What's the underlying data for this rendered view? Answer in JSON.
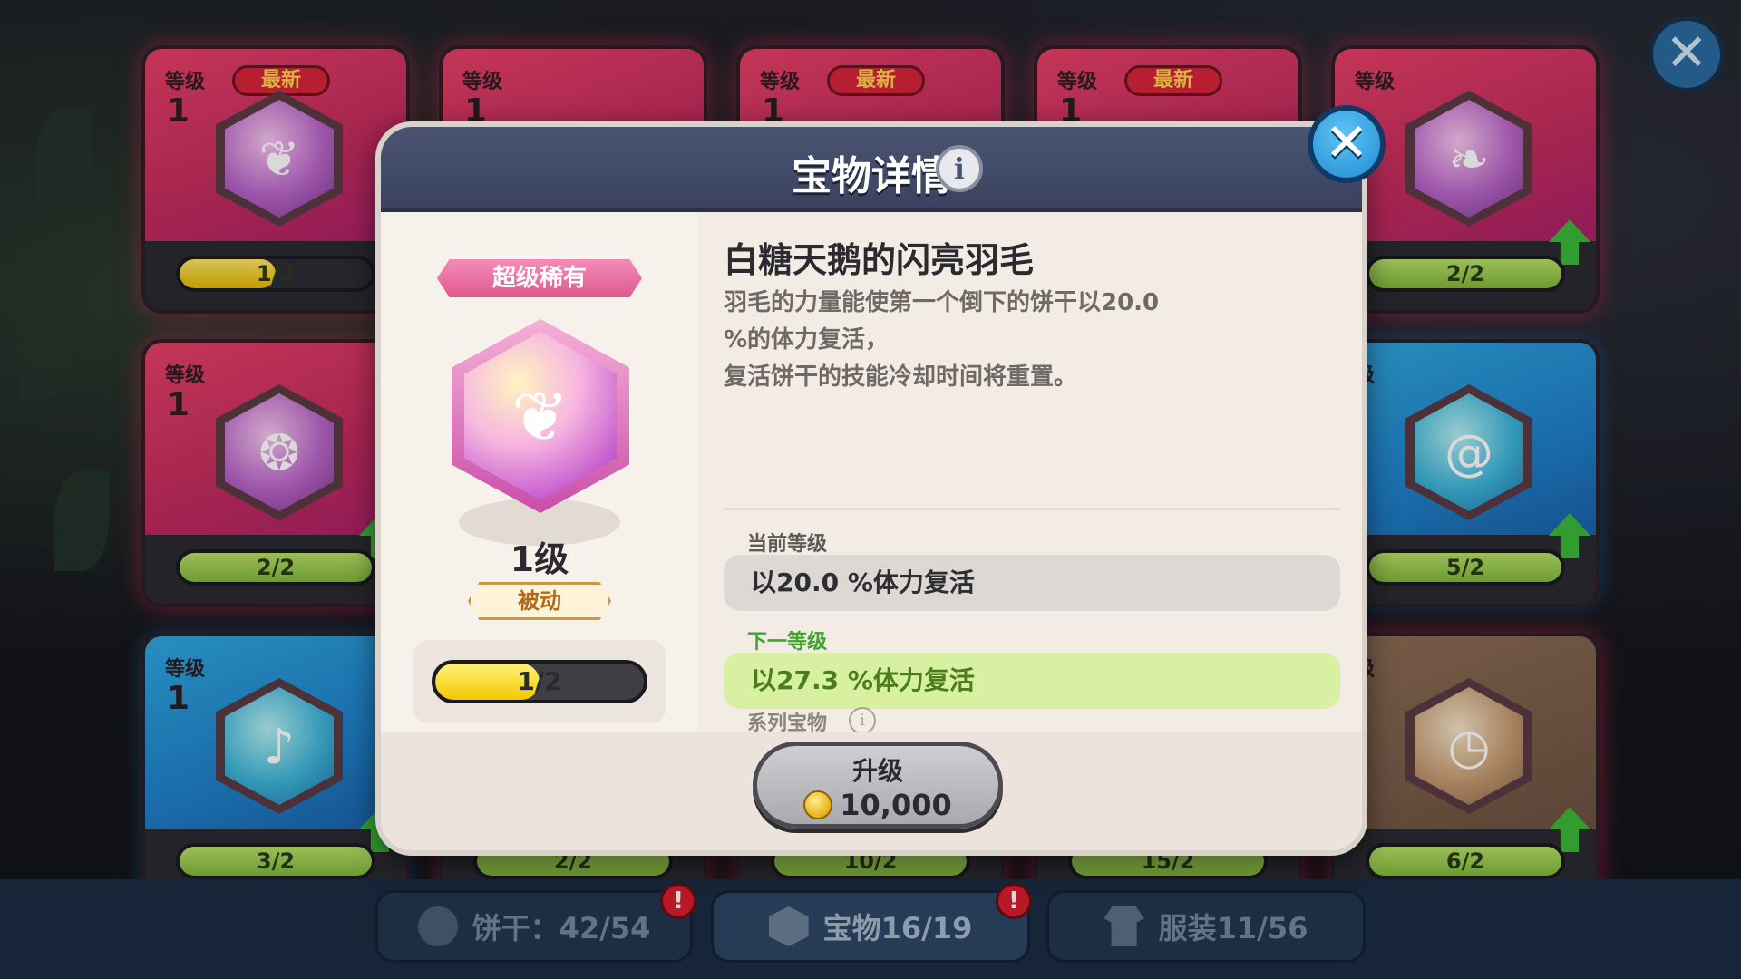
{
  "background_cards": [
    {
      "level_label": "等级",
      "level": "1",
      "new_badge": "最新",
      "progress": "1/2",
      "progress_frac": 0.5,
      "theme": "red",
      "icon": "feather-icon"
    },
    {
      "level_label": "等级",
      "level": "1",
      "new_badge": "",
      "progress": "",
      "progress_frac": 0,
      "theme": "red",
      "icon": ""
    },
    {
      "level_label": "等级",
      "level": "1",
      "new_badge": "最新",
      "progress": "",
      "progress_frac": 0,
      "theme": "red",
      "icon": ""
    },
    {
      "level_label": "等级",
      "level": "1",
      "new_badge": "最新",
      "progress": "",
      "progress_frac": 0,
      "theme": "red",
      "icon": ""
    },
    {
      "level_label": "等级",
      "level": "",
      "new_badge": "",
      "progress": "2/2",
      "progress_frac": 1,
      "theme": "red",
      "icon": "branch-icon"
    },
    {
      "level_label": "等级",
      "level": "1",
      "new_badge": "",
      "progress": "2/2",
      "progress_frac": 1,
      "theme": "red",
      "icon": "pouch-icon"
    },
    {
      "level_label": "级",
      "level": "",
      "new_badge": "",
      "progress": "5/2",
      "progress_frac": 1,
      "theme": "blue",
      "icon": "swirl-icon"
    },
    {
      "level_label": "等级",
      "level": "1",
      "new_badge": "",
      "progress": "3/2",
      "progress_frac": 1,
      "theme": "blue",
      "icon": "horn-icon"
    },
    {
      "level_label": "级",
      "level": "",
      "new_badge": "",
      "progress": "6/2",
      "progress_frac": 1,
      "theme": "brown",
      "icon": "stopwatch-icon"
    }
  ],
  "hidden_card_progress": [
    "2/2",
    "10/2",
    "15/2"
  ],
  "bottom_tabs": [
    {
      "label": "饼干：42/54",
      "icon": "cookie-icon",
      "alert": "!"
    },
    {
      "label": "宝物16/19",
      "icon": "treasure-icon",
      "alert": "!"
    },
    {
      "label": "服装11/56",
      "icon": "costume-icon",
      "alert": ""
    }
  ],
  "modal": {
    "title": "宝物详情",
    "info_glyph": "i",
    "close_glyph": "✕",
    "rarity": "超级稀有",
    "item_level": "1级",
    "item_type": "被动",
    "progress_text": "1/2",
    "progress_value": 0.5,
    "item_name": "白糖天鹅的闪亮羽毛",
    "description_lines": [
      "羽毛的力量能使第一个倒下的饼干以20.0",
      "%的体力复活，",
      "复活饼干的技能冷却时间将重置。"
    ],
    "current_level_label": "当前等级",
    "current_level_value": "以20.0 %体力复活",
    "next_level_label": "下一等级",
    "next_level_value": "以27.3 %体力复活",
    "series_label": "系列宝物",
    "upgrade_label": "升级",
    "upgrade_cost": "10,000"
  },
  "bg_close_glyph": "✕",
  "colors": {
    "modal_header": "#4a5470",
    "next_level_bg": "#d7f0a2",
    "next_level_label": "#3fa52a",
    "rarity_pink": "#e0588f",
    "close_blue": "#1f8ad4"
  }
}
